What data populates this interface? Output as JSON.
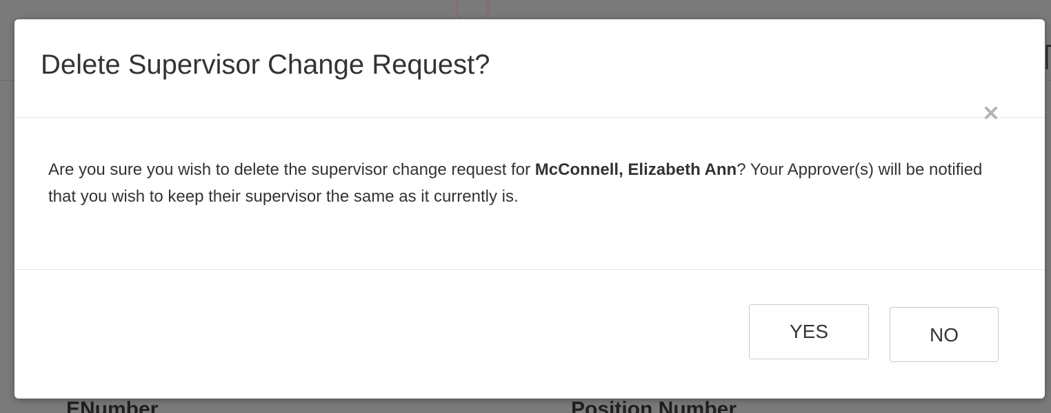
{
  "background": {
    "label_left": "ENumber",
    "label_right": "Position Number"
  },
  "dialog": {
    "title": "Delete Supervisor Change Request?",
    "close_icon": "close-icon",
    "body": {
      "text_before": "Are you sure you wish to delete the supervisor change request for ",
      "employee_name": "McConnell, Elizabeth Ann",
      "text_after": "? Your Approver(s) will be notified that you wish to keep their supervisor the same as it currently is."
    },
    "buttons": {
      "yes_label": "YES",
      "no_label": "NO"
    }
  },
  "colors": {
    "overlay": "#7a7a7a",
    "modal_background": "#ffffff",
    "text": "#333333",
    "divider": "#e5e5e5",
    "button_border": "#c9c9c9"
  }
}
